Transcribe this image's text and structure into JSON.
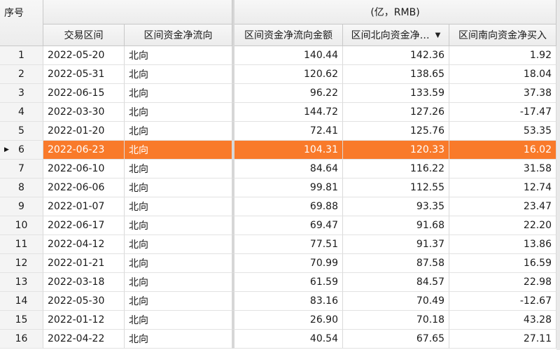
{
  "header": {
    "col_index": "序号",
    "unit_group": "(亿，RMB)",
    "col_date": "交易区间",
    "col_direction": "区间资金净流向",
    "col_net": "区间资金净流向金额",
    "col_north": "区间北向资金净…",
    "col_south": "区间南向资金净买入",
    "sort_icon": "sort-desc-icon"
  },
  "selected_row": 6,
  "rows": [
    {
      "idx": "1",
      "date": "2022-05-20",
      "direction": "北向",
      "net": "140.44",
      "north": "142.36",
      "south": "1.92"
    },
    {
      "idx": "2",
      "date": "2022-05-31",
      "direction": "北向",
      "net": "120.62",
      "north": "138.65",
      "south": "18.04"
    },
    {
      "idx": "3",
      "date": "2022-06-15",
      "direction": "北向",
      "net": "96.22",
      "north": "133.59",
      "south": "37.38"
    },
    {
      "idx": "4",
      "date": "2022-03-30",
      "direction": "北向",
      "net": "144.72",
      "north": "127.26",
      "south": "-17.47"
    },
    {
      "idx": "5",
      "date": "2022-01-20",
      "direction": "北向",
      "net": "72.41",
      "north": "125.76",
      "south": "53.35"
    },
    {
      "idx": "6",
      "date": "2022-06-23",
      "direction": "北向",
      "net": "104.31",
      "north": "120.33",
      "south": "16.02"
    },
    {
      "idx": "7",
      "date": "2022-06-10",
      "direction": "北向",
      "net": "84.64",
      "north": "116.22",
      "south": "31.58"
    },
    {
      "idx": "8",
      "date": "2022-06-06",
      "direction": "北向",
      "net": "99.81",
      "north": "112.55",
      "south": "12.74"
    },
    {
      "idx": "9",
      "date": "2022-01-07",
      "direction": "北向",
      "net": "69.88",
      "north": "93.35",
      "south": "23.47"
    },
    {
      "idx": "10",
      "date": "2022-06-17",
      "direction": "北向",
      "net": "69.47",
      "north": "91.68",
      "south": "22.20"
    },
    {
      "idx": "11",
      "date": "2022-04-12",
      "direction": "北向",
      "net": "77.51",
      "north": "91.37",
      "south": "13.86"
    },
    {
      "idx": "12",
      "date": "2022-01-21",
      "direction": "北向",
      "net": "70.99",
      "north": "87.58",
      "south": "16.59"
    },
    {
      "idx": "13",
      "date": "2022-03-18",
      "direction": "北向",
      "net": "61.59",
      "north": "84.57",
      "south": "22.98"
    },
    {
      "idx": "14",
      "date": "2022-05-30",
      "direction": "北向",
      "net": "83.16",
      "north": "70.49",
      "south": "-12.67"
    },
    {
      "idx": "15",
      "date": "2022-01-12",
      "direction": "北向",
      "net": "26.90",
      "north": "70.18",
      "south": "43.28"
    },
    {
      "idx": "16",
      "date": "2022-04-22",
      "direction": "北向",
      "net": "40.54",
      "north": "67.65",
      "south": "27.11"
    }
  ]
}
